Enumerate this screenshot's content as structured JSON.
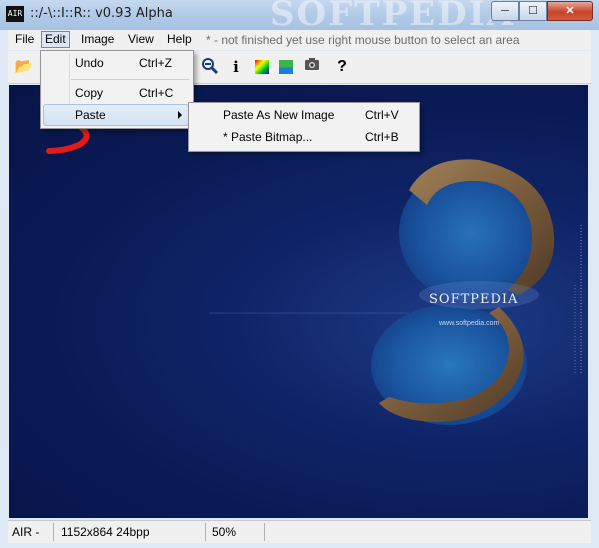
{
  "window": {
    "title": "::/-\\::I::R:: v0.93 Alpha",
    "icon_text": "AIR",
    "watermark": "SOFTPEDIA",
    "controls": {
      "minimize": "─",
      "maximize": "☐",
      "close": "✕"
    }
  },
  "menubar": {
    "items": [
      "File",
      "Edit",
      "Image",
      "View",
      "Help"
    ],
    "active": "Edit",
    "hint": "* - not finished yet     use right mouse button to select an area"
  },
  "toolbar": {
    "icons": [
      "folder-icon",
      "zoom-out-icon",
      "info-icon",
      "color-picker-icon",
      "landscape-icon",
      "camera-icon",
      "help-icon"
    ],
    "glyphs": {
      "folder": "📂",
      "zoom_out": "🔍",
      "info": "i",
      "help": "?",
      "camera": "📷"
    }
  },
  "edit_menu": {
    "items": [
      {
        "label": "Undo",
        "shortcut": "Ctrl+Z"
      },
      {
        "label": "Copy",
        "shortcut": "Ctrl+C"
      },
      {
        "label": "Paste",
        "shortcut": ""
      }
    ],
    "highlighted": "Paste"
  },
  "paste_submenu": {
    "items": [
      {
        "label": "Paste As New Image",
        "shortcut": "Ctrl+V"
      },
      {
        "label": "* Paste Bitmap...",
        "shortcut": "Ctrl+B"
      }
    ]
  },
  "canvas": {
    "brand": "SOFTPEDIA",
    "url": "www.softpedia.com",
    "bg_color": "#0d215f"
  },
  "statusbar": {
    "app": "AIR -",
    "image_info": "1152x864 24bpp",
    "zoom": "50%"
  }
}
